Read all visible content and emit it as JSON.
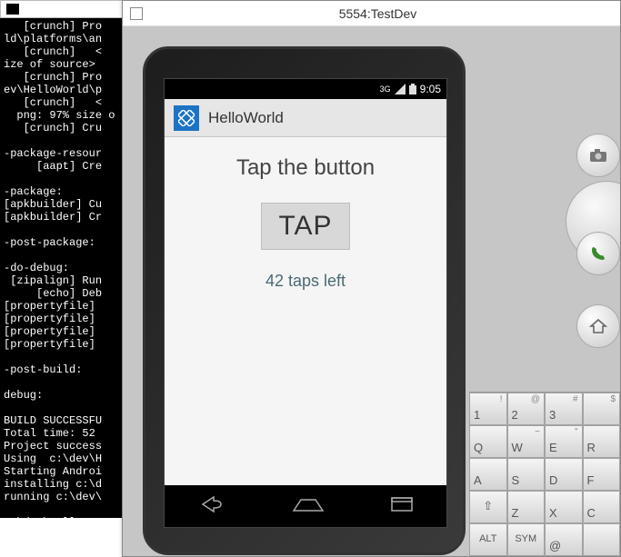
{
  "terminal": {
    "icon_label": "C:\\",
    "lines": "   [crunch] Pro\nld\\platforms\\an\n   [crunch]   <\nize of source>\n   [crunch] Pro\nev\\HelloWorld\\p\n   [crunch]   <\n  png: 97% size o\n   [crunch] Cru\n\n-package-resour\n     [aapt] Cre\n\n-package:\n[apkbuilder] Cu\n[apkbuilder] Cr\n\n-post-package:\n\n-do-debug:\n [zipalign] Run\n     [echo] Deb\n[propertyfile]\n[propertyfile]\n[propertyfile]\n[propertyfile]\n\n-post-build:\n\ndebug:\n\nBUILD SUCCESSFU\nTotal time: 52 \nProject success\nUsing  c:\\dev\\H\nStarting Androi\ninstalling c:\\d\nrunning c:\\dev\\\n\nc:\\dev\\HelloWor"
  },
  "emulator": {
    "title": "5554:TestDev",
    "status": {
      "net": "3G",
      "time": "9:05"
    },
    "app": {
      "title": "HelloWorld",
      "heading": "Tap the button",
      "button_label": "TAP",
      "counter_text": "42 taps left"
    },
    "side_buttons": {
      "camera": "camera-icon",
      "call": "phone-icon",
      "home": "home-icon"
    },
    "keyboard": {
      "row1": [
        {
          "main": "1",
          "sup": "!"
        },
        {
          "main": "2",
          "sup": "@"
        },
        {
          "main": "3",
          "sup": "#"
        },
        {
          "main": "",
          "sup": "$"
        }
      ],
      "row2": [
        {
          "main": "Q",
          "sup": ""
        },
        {
          "main": "W",
          "sup": "~"
        },
        {
          "main": "E",
          "sup": "\""
        },
        {
          "main": "R",
          "sup": ""
        }
      ],
      "row3": [
        {
          "main": "A",
          "sup": ""
        },
        {
          "main": "S",
          "sup": ""
        },
        {
          "main": "D",
          "sup": ""
        },
        {
          "main": "F",
          "sup": ""
        }
      ],
      "row4": [
        {
          "main": "⇧",
          "sup": ""
        },
        {
          "main": "Z",
          "sup": ""
        },
        {
          "main": "X",
          "sup": ""
        },
        {
          "main": "C",
          "sup": ""
        }
      ],
      "row5": [
        {
          "main": "ALT",
          "sup": ""
        },
        {
          "main": "SYM",
          "sup": ""
        },
        {
          "main": "@",
          "sup": ""
        },
        {
          "main": "",
          "sup": ""
        }
      ]
    }
  }
}
